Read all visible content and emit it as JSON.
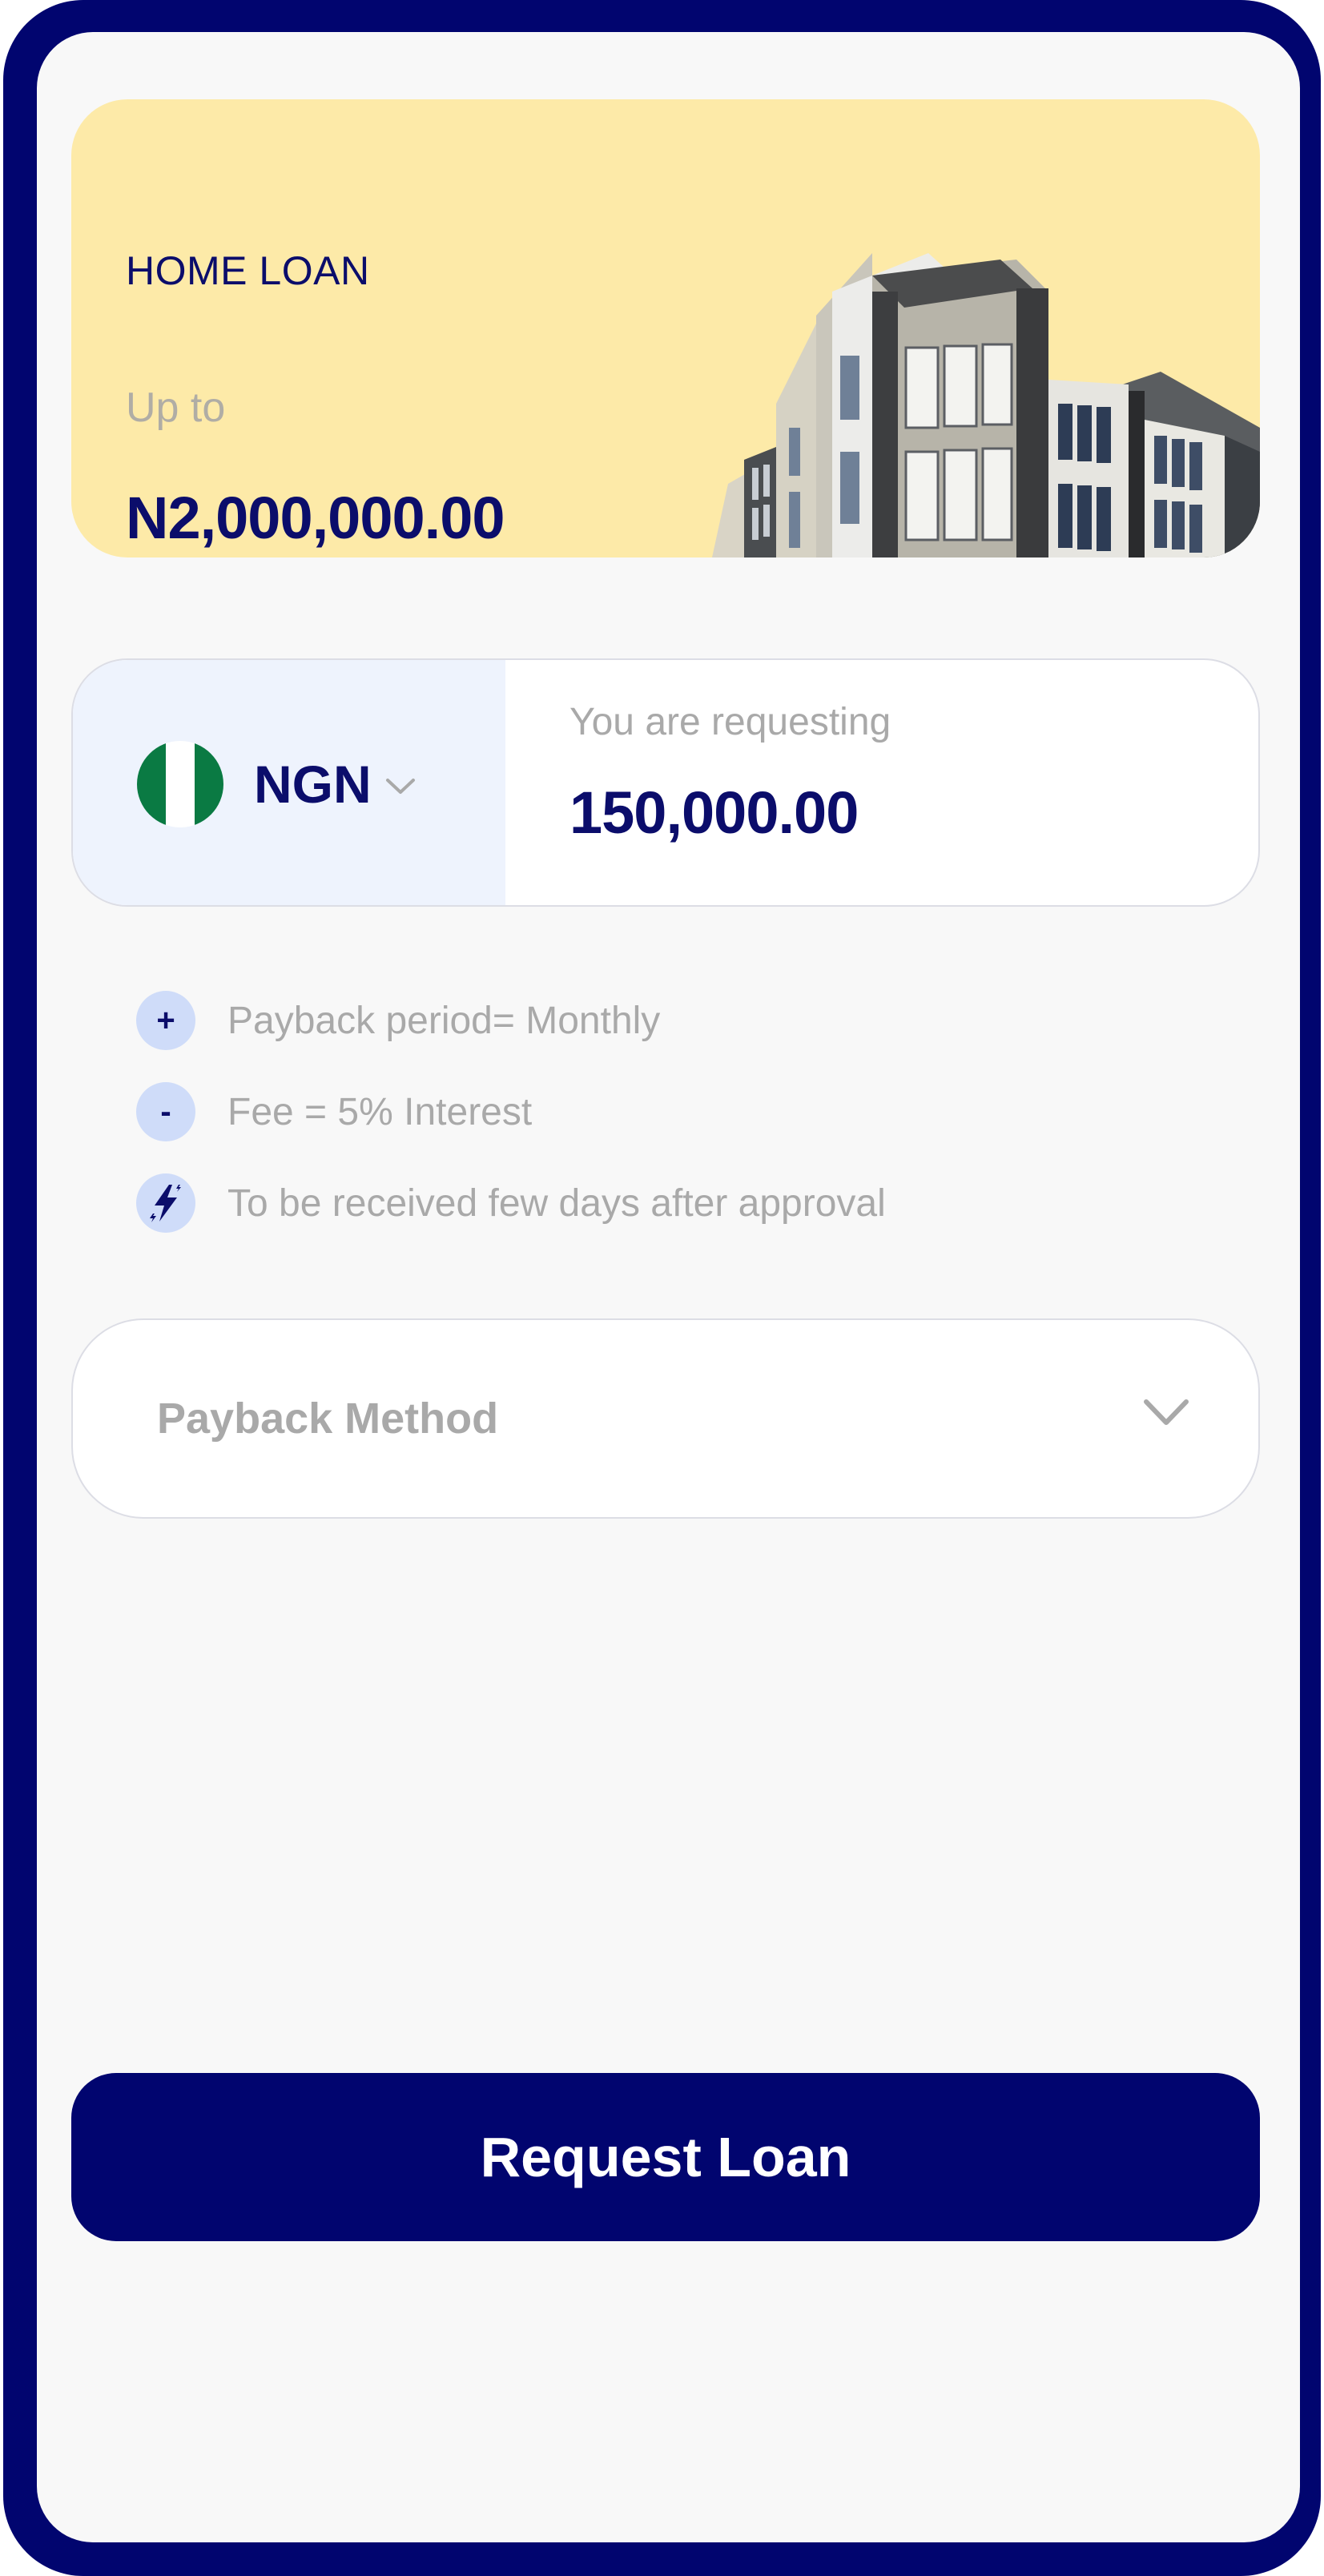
{
  "banner": {
    "title": "HOME LOAN",
    "up_to_label": "Up to",
    "amount": "N2,000,000.00"
  },
  "request": {
    "currency_code": "NGN",
    "label": "You are requesting",
    "amount": "150,000.00"
  },
  "info": [
    {
      "icon": "plus-icon",
      "symbol": "+",
      "text": "Payback period= Monthly"
    },
    {
      "icon": "minus-icon",
      "symbol": "-",
      "text": "Fee = 5% Interest"
    },
    {
      "icon": "lightning-icon",
      "symbol": "",
      "text": "To be received few days after approval"
    }
  ],
  "payback": {
    "label": "Payback Method"
  },
  "button": {
    "label": "Request Loan"
  },
  "colors": {
    "brand_navy": "#01056f",
    "banner_bg": "#fdeaa8",
    "currency_bg": "#eef3fd",
    "badge_bg": "#cfdcf9",
    "muted_text": "#a9a9a9",
    "flag_green": "#0a7a43"
  }
}
